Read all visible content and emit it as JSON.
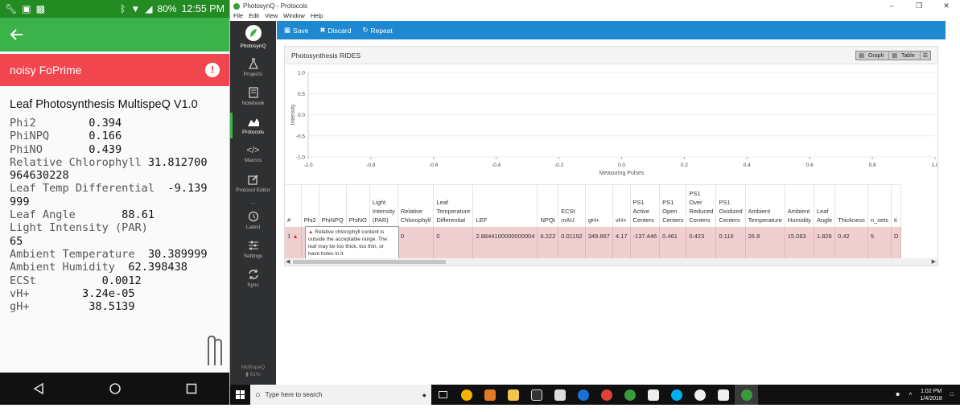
{
  "phone": {
    "status": {
      "battery": "80%",
      "time": "12:55 PM"
    },
    "alert": {
      "text": "noisy FoPrime",
      "icon": "alert-circle-icon"
    },
    "title": "Leaf Photosynthesis MultispeQ V1.0",
    "lines": [
      {
        "k": "Phi2        ",
        "v": "0.394"
      },
      {
        "k": "PhiNPQ      ",
        "v": "0.166"
      },
      {
        "k": "PhiNO       ",
        "v": "0.439"
      },
      {
        "k": "Relative Chlorophyll ",
        "v": "31.812700"
      },
      {
        "k": "",
        "v": "964630228"
      },
      {
        "k": "Leaf Temp Differential  ",
        "v": "-9.139"
      },
      {
        "k": "",
        "v": "999"
      },
      {
        "k": "Leaf Angle       ",
        "v": "88.61"
      },
      {
        "k": "Light Intensity (PAR)",
        "v": ""
      },
      {
        "k": "",
        "v": "65"
      },
      {
        "k": "Ambient Temperature  ",
        "v": "30.389999"
      },
      {
        "k": "Ambient Humidity  ",
        "v": "62.398438"
      },
      {
        "k": "ECSt          ",
        "v": "0.0012"
      },
      {
        "k": "vH+        ",
        "v": "3.24e-05"
      },
      {
        "k": "gH+         ",
        "v": "38.5139"
      }
    ]
  },
  "window": {
    "title": "PhotosynQ - Protocols",
    "menu": [
      "File",
      "Edit",
      "View",
      "Window",
      "Help"
    ]
  },
  "sidebar": {
    "brand": "PhotosynQ",
    "items": [
      {
        "label": "Projects"
      },
      {
        "label": "Notebook"
      },
      {
        "label": "Protocols"
      },
      {
        "label": "Macros"
      },
      {
        "label": "Protocol Editor"
      },
      {
        "label": "Latest"
      },
      {
        "label": "Settings"
      },
      {
        "label": "Sync"
      }
    ],
    "device": "MultispeQ",
    "device_battery": "61%"
  },
  "toolbar": {
    "save": "Save",
    "discard": "Discard",
    "repeat": "Repeat"
  },
  "panel": {
    "title": "Photosynthesis RIDES",
    "graph_btn": "Graph",
    "table_btn": "Table"
  },
  "chart_data": {
    "type": "line",
    "title": "",
    "xlabel": "Measuring Pulses",
    "ylabel": "Intensity",
    "xlim": [
      -1.0,
      1.0
    ],
    "ylim": [
      -1.0,
      1.0
    ],
    "xticks": [
      "-1.0",
      "-0.8",
      "-0.6",
      "-0.4",
      "-0.2",
      "0.0",
      "0.2",
      "0.4",
      "0.6",
      "0.8",
      "1.0"
    ],
    "yticks": [
      "1.0",
      "0.5",
      "0.0",
      "-0.5",
      "-1.0"
    ],
    "series": []
  },
  "table": {
    "headers": [
      [
        "#"
      ],
      [
        "Phi2"
      ],
      [
        "PhiNPQ"
      ],
      [
        "PhiNO"
      ],
      [
        "Light",
        "Intensity",
        "(PAR)"
      ],
      [
        "Relative",
        "Chlorophyll"
      ],
      [
        "Leaf",
        "Temperature",
        "Differential"
      ],
      [
        "LEF"
      ],
      [
        "NPQt"
      ],
      [
        "ECSt",
        "mAU"
      ],
      [
        "gH+"
      ],
      [
        "vH+"
      ],
      [
        "PS1",
        "Active",
        "Centers"
      ],
      [
        "PS1",
        "Open",
        "Centers"
      ],
      [
        "PS1",
        "Over",
        "Reduced",
        "Centers"
      ],
      [
        "PS1",
        "Oxidized",
        "Centers"
      ],
      [
        "Ambient",
        "Temperature"
      ],
      [
        "Ambient",
        "Humidity"
      ],
      [
        "Leaf",
        "Angle"
      ],
      [
        "Thickness"
      ],
      [
        "n_sets"
      ],
      [
        "ti"
      ]
    ],
    "row": [
      "1",
      "",
      "",
      "",
      "",
      "0",
      "0",
      "2.8844100000000004",
      "6.222",
      "0.01192",
      "349.867",
      "4.17",
      "-137.446",
      "0.461",
      "0.423",
      "0.116",
      "26.8",
      "15.083",
      "1.828",
      "0.42",
      "5",
      "D"
    ],
    "tooltip": "Relative chlorophyll content is outside the acceptable range. The leaf may be too thick, too thin, or have holes in it."
  },
  "taskbar": {
    "search_placeholder": "Type here to search",
    "time": "1:02 PM",
    "date": "1/4/2018"
  }
}
